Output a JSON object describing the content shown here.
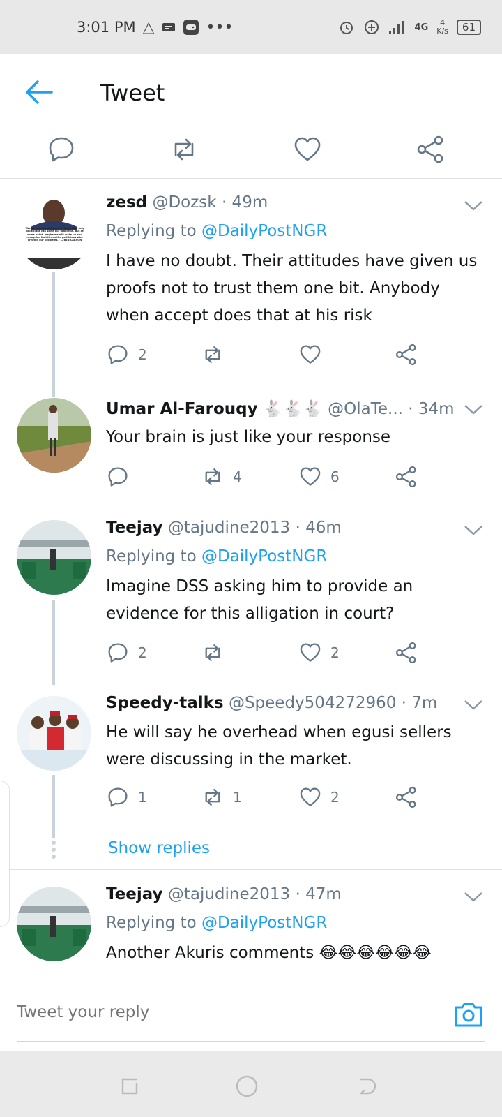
{
  "status_bar": {
    "time": "3:01 PM",
    "network": "4G",
    "speed_value": "4",
    "speed_unit": "K/s",
    "battery": "61"
  },
  "header": {
    "title": "Tweet"
  },
  "replies": [
    {
      "display_name": "zesd",
      "handle": "@Dozsk",
      "time": "· 49m",
      "replying_prefix": "Replying to",
      "replying_to": "@DailyPostNGR",
      "text": "I have no doubt. Their attitudes have given us proofs not to trust them one bit. Anybody when accept does that at his risk",
      "reply_count": "2",
      "retweet_count": "",
      "like_count": "",
      "avatar_quote": "\"We've been conditioned to think that only politicians can solve our problems. But at some point, maybe we will wake up and recognize that it was the politicians who created our problems.\" — BEN CARSON"
    },
    {
      "display_name": "Umar Al-Farouqy",
      "emoji": "🐇🐇🐇",
      "handle": "@OlaTe...",
      "time": "· 34m",
      "text": "Your brain is just like your response",
      "reply_count": "",
      "retweet_count": "4",
      "like_count": "6"
    },
    {
      "display_name": "Teejay",
      "handle": "@tajudine2013",
      "time": "· 46m",
      "replying_prefix": "Replying to",
      "replying_to": "@DailyPostNGR",
      "text": "Imagine DSS asking him to provide an evidence for this alligation in court?",
      "reply_count": "2",
      "retweet_count": "",
      "like_count": "2"
    },
    {
      "display_name": "Speedy-talks",
      "handle": "@Speedy504272960",
      "time": "· 7m",
      "text": "He will say he overhead when egusi sellers were discussing in the market.",
      "reply_count": "1",
      "retweet_count": "1",
      "like_count": "2",
      "show_replies": "Show replies"
    },
    {
      "display_name": "Teejay",
      "handle": "@tajudine2013",
      "time": "· 47m",
      "replying_prefix": "Replying to",
      "replying_to": "@DailyPostNGR",
      "text": "Another Akuris comments 😂😂😂😂😂😂"
    }
  ],
  "composer": {
    "placeholder": "Tweet your reply"
  },
  "colors": {
    "accent": "#1da1f2",
    "secondary_text": "#657786",
    "thread_line": "#c9d3db"
  }
}
